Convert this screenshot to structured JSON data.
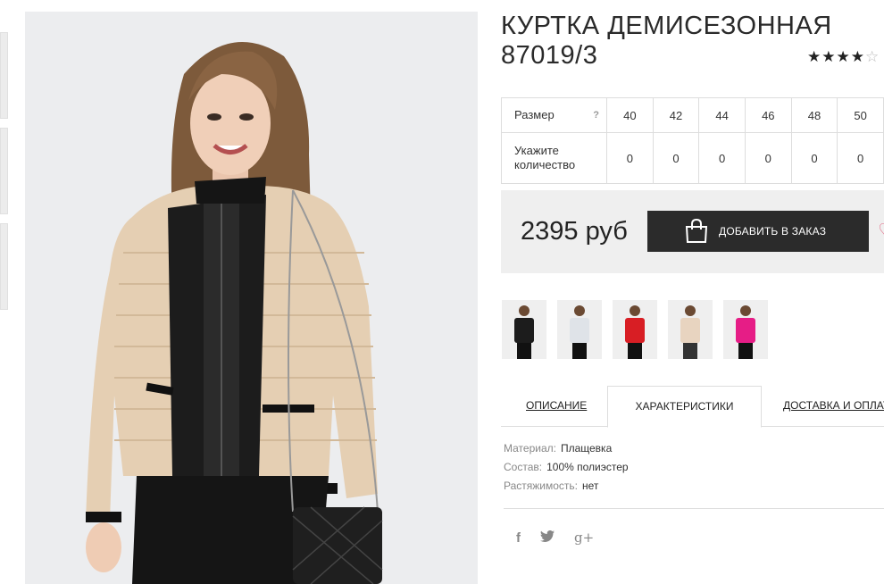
{
  "product": {
    "title": "КУРТКА ДЕМИСЕЗОННАЯ 87019/3",
    "rating": 4,
    "rating_max": 5
  },
  "size_table": {
    "size_label": "Размер",
    "help_mark": "?",
    "qty_label": "Укажите количество",
    "sizes": [
      "40",
      "42",
      "44",
      "46",
      "48",
      "50"
    ],
    "quantities": [
      "0",
      "0",
      "0",
      "0",
      "0",
      "0"
    ]
  },
  "buy": {
    "price": "2395 руб",
    "add_button": "ДОБАВИТЬ В ЗАКАЗ"
  },
  "color_swatches": [
    {
      "jacket": "#1c1c1c"
    },
    {
      "jacket": "#dfe3e8"
    },
    {
      "jacket": "#d81e24"
    },
    {
      "jacket": "#e8d4c0"
    },
    {
      "jacket": "#e61d86"
    }
  ],
  "tabs": {
    "description": "ОПИСАНИЕ",
    "specs": "ХАРАКТЕРИСТИКИ",
    "delivery": "ДОСТАВКА И ОПЛАТА"
  },
  "specs": {
    "material_key": "Материал:",
    "material_val": "Плащевка",
    "composition_key": "Состав:",
    "composition_val": "100% полиэстер",
    "stretch_key": "Растяжимость:",
    "stretch_val": "нет"
  },
  "social": {
    "facebook": "f",
    "twitter": "t",
    "gplus": "g+"
  },
  "colors": {
    "button_bg": "#2b2b2b",
    "buybox_bg": "#efefef",
    "jacket_main": "#e5cfb3",
    "heart": "#e46a86"
  }
}
